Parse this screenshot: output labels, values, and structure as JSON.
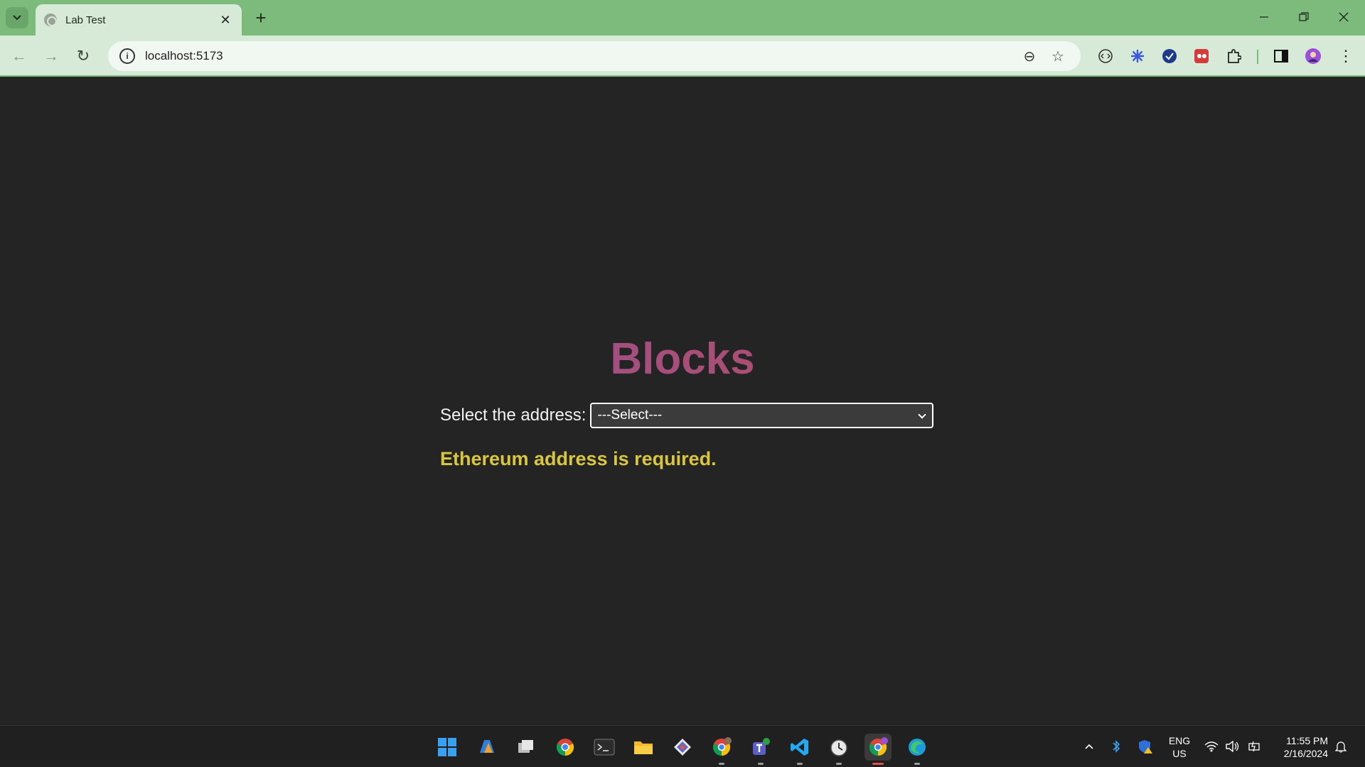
{
  "browser": {
    "tab_title": "Lab Test",
    "url": "localhost:5173",
    "close_glyph": "✕",
    "newtab_glyph": "+",
    "back_glyph": "←",
    "forward_glyph": "→",
    "reload_glyph": "↻",
    "site_info_glyph": "i",
    "zoom_glyph": "⊖",
    "star_glyph": "☆",
    "menu_glyph": "⋮"
  },
  "page": {
    "title": "Blocks",
    "select_label": "Select the address:",
    "select_value": "---Select---",
    "error_message": "Ethereum address is required."
  },
  "taskbar": {
    "language": "ENG",
    "region": "US",
    "time": "11:55 PM",
    "date": "2/16/2024"
  },
  "colors": {
    "page_background": "#242424",
    "chrome_frame": "#7dbb7d",
    "error_text": "#d9c63f",
    "title_gradient_start": "#7a55b8",
    "title_gradient_end": "#c54a4a"
  }
}
